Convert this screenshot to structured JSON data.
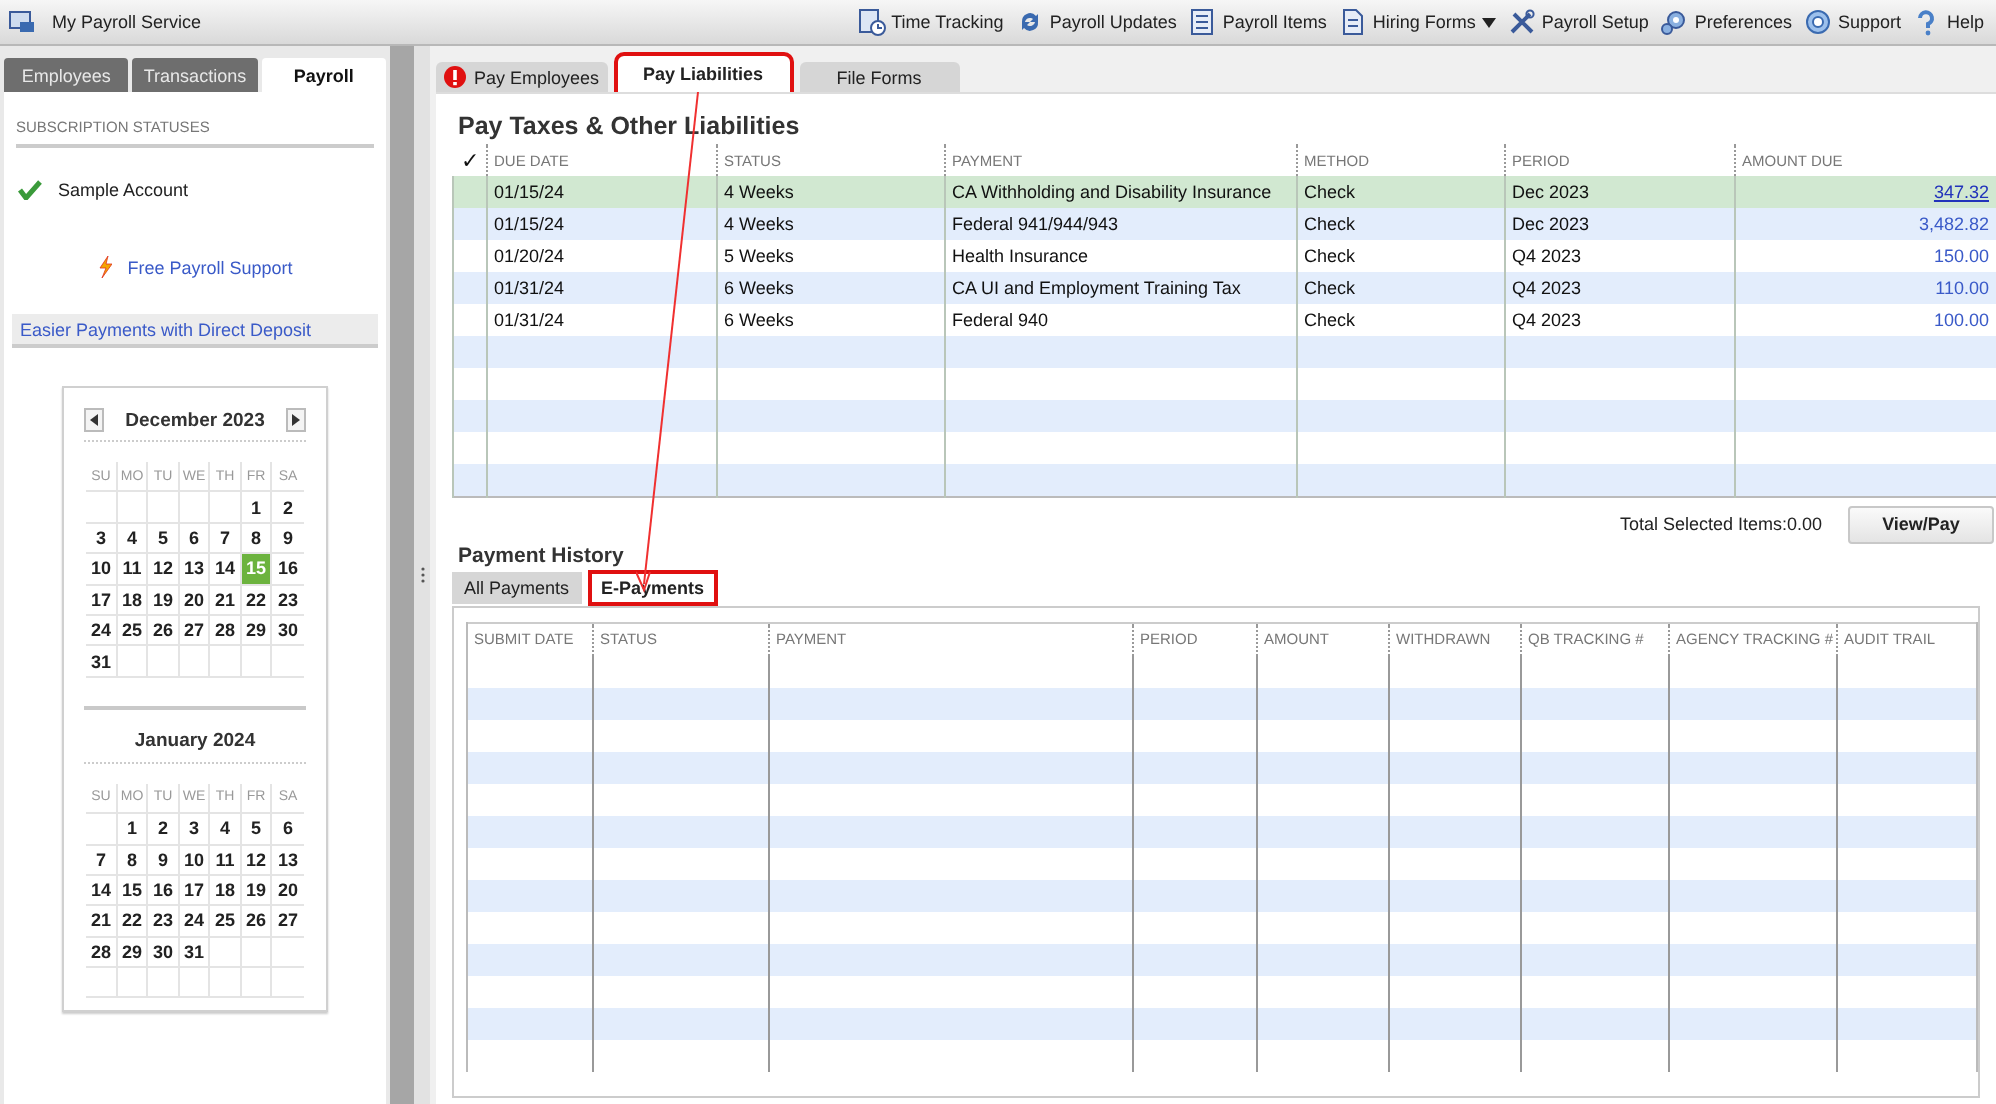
{
  "app_bar": {
    "title": "My Payroll Service",
    "menu": [
      {
        "label": "Time Tracking",
        "kind": "clock",
        "has_menu": false
      },
      {
        "label": "Payroll Updates",
        "kind": "refresh",
        "has_menu": false
      },
      {
        "label": "Payroll Items",
        "kind": "list",
        "has_menu": false
      },
      {
        "label": "Hiring Forms",
        "kind": "document",
        "has_menu": true
      },
      {
        "label": "Payroll Setup",
        "kind": "tools",
        "has_menu": false
      },
      {
        "label": "Preferences",
        "kind": "gears",
        "has_menu": false
      },
      {
        "label": "Support",
        "kind": "lifebuoy",
        "has_menu": false
      },
      {
        "label": "Help",
        "kind": "question",
        "has_menu": false
      }
    ]
  },
  "sidebar": {
    "tabs": [
      {
        "label": "Employees",
        "selected": false
      },
      {
        "label": "Transactions",
        "selected": false
      },
      {
        "label": "Payroll",
        "selected": true
      }
    ],
    "section_title": "SUBSCRIPTION STATUSES",
    "account": "Sample Account",
    "support_link": "Free Payroll Support",
    "promo": "Easier Payments with Direct Deposit",
    "calendars": [
      {
        "title": "December 2023",
        "nav_arrows": true,
        "weekdays": [
          "SU",
          "MO",
          "TU",
          "WE",
          "TH",
          "FR",
          "SA"
        ],
        "weeks": [
          [
            {
              "day": "1",
              "selected": false
            },
            {
              "day": "2",
              "selected": false
            }
          ],
          [
            {
              "day": "3",
              "selected": false
            },
            {
              "day": "4",
              "selected": false
            },
            {
              "day": "5",
              "selected": false
            },
            {
              "day": "6",
              "selected": false
            },
            {
              "day": "7",
              "selected": false
            },
            {
              "day": "8",
              "selected": false
            },
            {
              "day": "9",
              "selected": false
            }
          ],
          [
            {
              "day": "10",
              "selected": false
            },
            {
              "day": "11",
              "selected": false
            },
            {
              "day": "12",
              "selected": false
            },
            {
              "day": "13",
              "selected": false
            },
            {
              "day": "14",
              "selected": false
            },
            {
              "day": "15",
              "selected": true
            },
            {
              "day": "16",
              "selected": false
            }
          ],
          [
            {
              "day": "17",
              "selected": false
            },
            {
              "day": "18",
              "selected": false
            },
            {
              "day": "19",
              "selected": false
            },
            {
              "day": "20",
              "selected": false
            },
            {
              "day": "21",
              "selected": false
            },
            {
              "day": "22",
              "selected": false
            },
            {
              "day": "23",
              "selected": false
            }
          ],
          [
            {
              "day": "24",
              "selected": false
            },
            {
              "day": "25",
              "selected": false
            },
            {
              "day": "26",
              "selected": false
            },
            {
              "day": "27",
              "selected": false
            },
            {
              "day": "28",
              "selected": false
            },
            {
              "day": "29",
              "selected": false
            },
            {
              "day": "30",
              "selected": false
            }
          ],
          [
            {
              "day": "31",
              "selected": false
            }
          ]
        ]
      },
      {
        "title": "January 2024",
        "nav_arrows": false,
        "weekdays": [
          "SU",
          "MO",
          "TU",
          "WE",
          "TH",
          "FR",
          "SA"
        ],
        "weeks": [
          [
            {
              "day": "1",
              "selected": false
            },
            {
              "day": "2",
              "selected": false
            },
            {
              "day": "3",
              "selected": false
            },
            {
              "day": "4",
              "selected": false
            },
            {
              "day": "5",
              "selected": false
            },
            {
              "day": "6",
              "selected": false
            }
          ],
          [
            {
              "day": "7",
              "selected": false
            },
            {
              "day": "8",
              "selected": false
            },
            {
              "day": "9",
              "selected": false
            },
            {
              "day": "10",
              "selected": false
            },
            {
              "day": "11",
              "selected": false
            },
            {
              "day": "12",
              "selected": false
            },
            {
              "day": "13",
              "selected": false
            }
          ],
          [
            {
              "day": "14",
              "selected": false
            },
            {
              "day": "15",
              "selected": false
            },
            {
              "day": "16",
              "selected": false
            },
            {
              "day": "17",
              "selected": false
            },
            {
              "day": "18",
              "selected": false
            },
            {
              "day": "19",
              "selected": false
            },
            {
              "day": "20",
              "selected": false
            }
          ],
          [
            {
              "day": "21",
              "selected": false
            },
            {
              "day": "22",
              "selected": false
            },
            {
              "day": "23",
              "selected": false
            },
            {
              "day": "24",
              "selected": false
            },
            {
              "day": "25",
              "selected": false
            },
            {
              "day": "26",
              "selected": false
            },
            {
              "day": "27",
              "selected": false
            }
          ],
          [
            {
              "day": "28",
              "selected": false
            },
            {
              "day": "29",
              "selected": false
            },
            {
              "day": "30",
              "selected": false
            },
            {
              "day": "31",
              "selected": false
            }
          ]
        ]
      }
    ]
  },
  "main": {
    "tabs": [
      {
        "label": "Pay Employees",
        "selected": false,
        "alert": true,
        "annotated": false
      },
      {
        "label": "Pay Liabilities",
        "selected": true,
        "alert": false,
        "annotated": true
      },
      {
        "label": "File Forms",
        "selected": false,
        "alert": false,
        "annotated": false
      }
    ],
    "liabilities": {
      "title": "Pay Taxes & Other Liabilities",
      "check_header": "✓",
      "columns": [
        "DUE DATE",
        "STATUS",
        "PAYMENT",
        "METHOD",
        "PERIOD",
        "AMOUNT DUE"
      ],
      "rows": [
        {
          "selected": true,
          "cells": [
            "01/15/24",
            "4 Weeks",
            "CA Withholding and Disability Insurance",
            "Check",
            "Dec 2023",
            "347.32"
          ]
        },
        {
          "selected": false,
          "cells": [
            "01/15/24",
            "4 Weeks",
            "Federal 941/944/943",
            "Check",
            "Dec 2023",
            "3,482.82"
          ]
        },
        {
          "selected": false,
          "cells": [
            "01/20/24",
            "5 Weeks",
            "Health Insurance",
            "Check",
            "Q4 2023",
            "150.00"
          ]
        },
        {
          "selected": false,
          "cells": [
            "01/31/24",
            "6 Weeks",
            "CA UI and Employment Training Tax",
            "Check",
            "Q4 2023",
            "110.00"
          ]
        },
        {
          "selected": false,
          "cells": [
            "01/31/24",
            "6 Weeks",
            "Federal 940",
            "Check",
            "Q4 2023",
            "100.00"
          ]
        }
      ]
    },
    "total_selected": "Total Selected Items:0.00",
    "view_pay_button": "View/Pay",
    "history": {
      "title": "Payment History",
      "tabs": [
        {
          "label": "All Payments",
          "selected": false,
          "annotated": false
        },
        {
          "label": "E-Payments",
          "selected": true,
          "annotated": true
        }
      ],
      "columns": [
        "SUBMIT DATE",
        "STATUS",
        "PAYMENT",
        "PERIOD",
        "AMOUNT",
        "WITHDRAWN",
        "QB TRACKING #",
        "AGENCY TRACKING #",
        "AUDIT TRAIL"
      ]
    }
  }
}
